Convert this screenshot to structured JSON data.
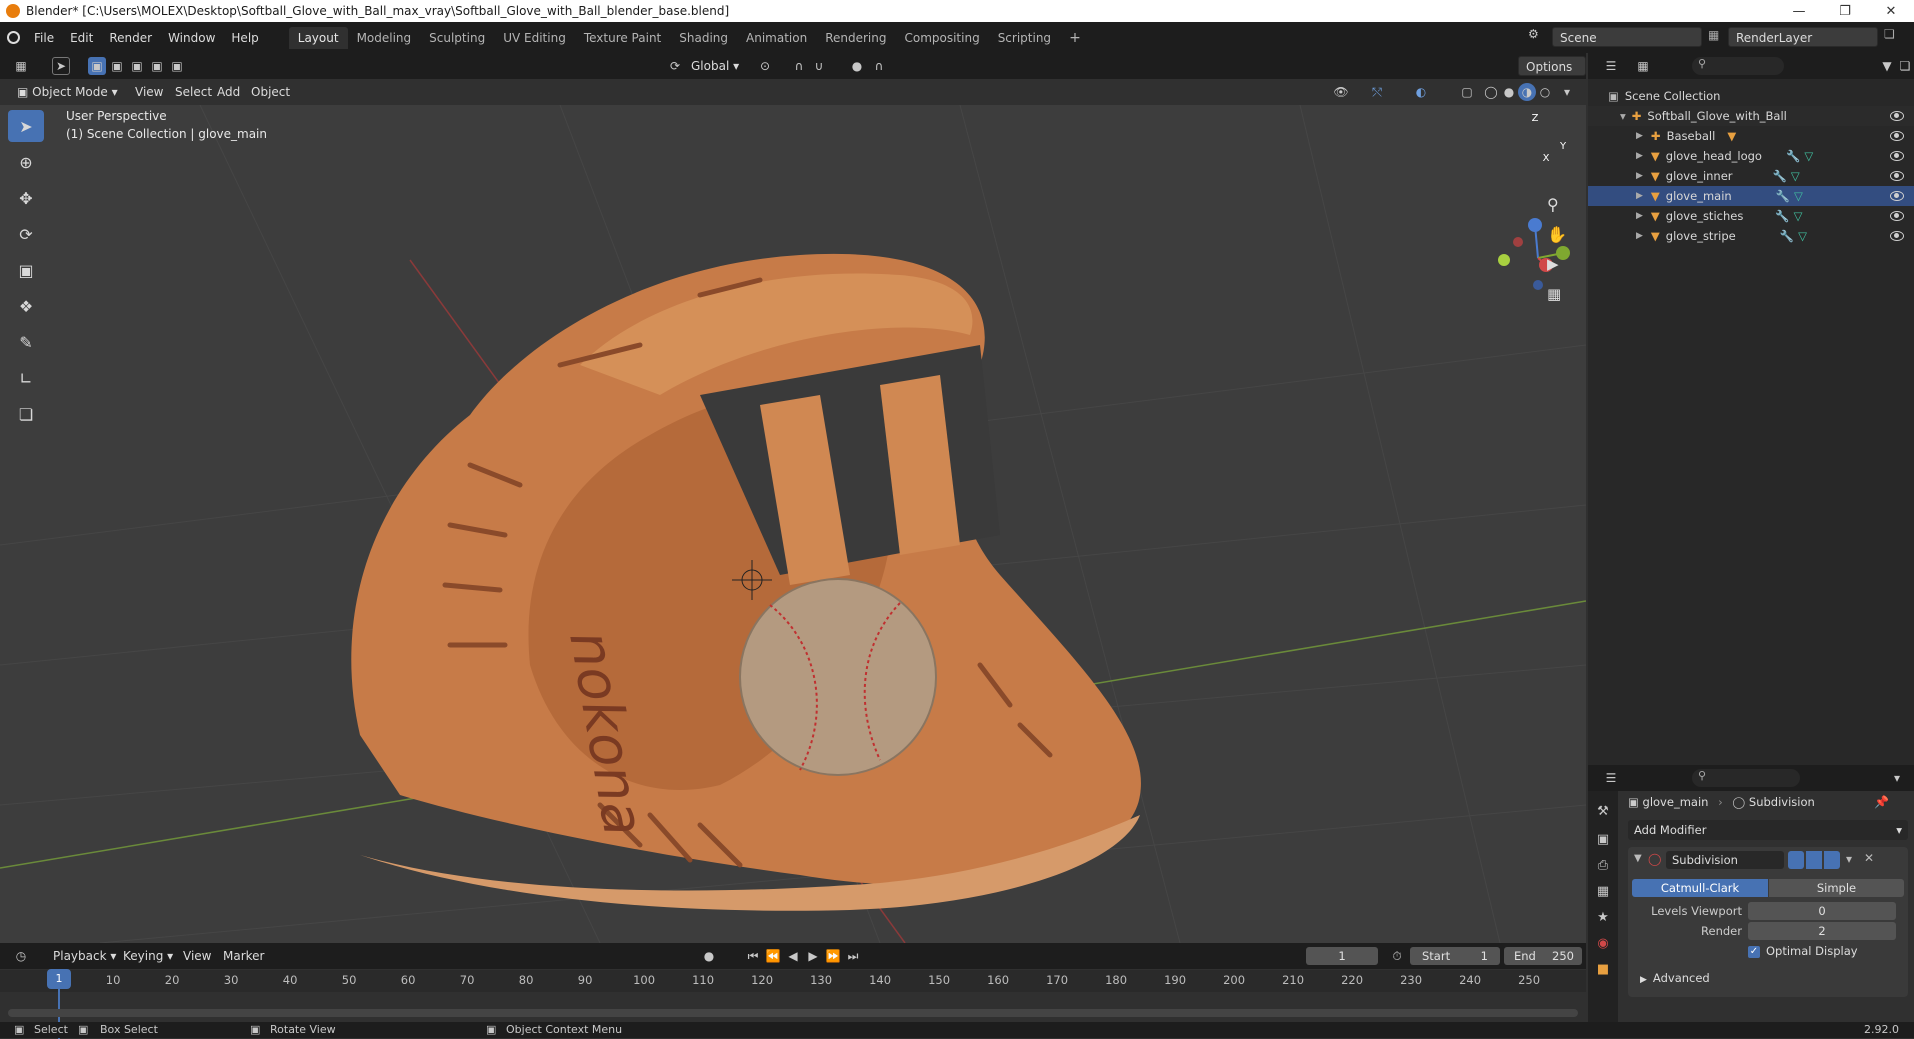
{
  "window": {
    "title": "Blender* [C:\\Users\\MOLEX\\Desktop\\Softball_Glove_with_Ball_max_vray\\Softball_Glove_with_Ball_blender_base.blend]"
  },
  "menu": [
    "File",
    "Edit",
    "Render",
    "Window",
    "Help"
  ],
  "workspaces": [
    "Layout",
    "Modeling",
    "Sculpting",
    "UV Editing",
    "Texture Paint",
    "Shading",
    "Animation",
    "Rendering",
    "Compositing",
    "Scripting"
  ],
  "scene": {
    "name": "Scene",
    "render_layer": "RenderLayer"
  },
  "viewport": {
    "transform_orientation": "Global",
    "options_label": "Options",
    "mode": "Object Mode",
    "header_menus": [
      "View",
      "Select",
      "Add",
      "Object"
    ],
    "overlay_line1": "User Perspective",
    "overlay_line2": "(1) Scene Collection | glove_main",
    "gizmo_axes": {
      "z": "Z",
      "y": "Y",
      "x": "X"
    }
  },
  "outliner": {
    "root": "Scene Collection",
    "collection": "Softball_Glove_with_Ball",
    "items": [
      "Baseball",
      "glove_head_logo",
      "glove_inner",
      "glove_main",
      "glove_stiches",
      "glove_stripe"
    ]
  },
  "properties": {
    "object": "glove_main",
    "modifier": "Subdivision",
    "add_modifier": "Add Modifier",
    "modifier_name": "Subdivision",
    "mode_a": "Catmull-Clark",
    "mode_b": "Simple",
    "levels_viewport_label": "Levels Viewport",
    "levels_viewport": "0",
    "render_label": "Render",
    "render": "2",
    "optimal_display": "Optimal Display",
    "advanced": "Advanced"
  },
  "timeline": {
    "menus": [
      "Playback",
      "Keying",
      "View",
      "Marker"
    ],
    "current_frame": "1",
    "start_label": "Start",
    "start": "1",
    "end_label": "End",
    "end": "250",
    "ticks": [
      "1",
      "10",
      "20",
      "30",
      "40",
      "50",
      "60",
      "70",
      "80",
      "90",
      "100",
      "110",
      "120",
      "130",
      "140",
      "150",
      "160",
      "170",
      "180",
      "190",
      "200",
      "210",
      "220",
      "230",
      "240",
      "250"
    ]
  },
  "status": {
    "select": "Select",
    "box_select": "Box Select",
    "rotate_view": "Rotate View",
    "context_menu": "Object Context Menu",
    "version": "2.92.0"
  },
  "colors": {
    "accent": "#4772b3",
    "orange": "#e87d0d",
    "header": "#1d1d1d",
    "viewport": "#3d3d3d"
  }
}
